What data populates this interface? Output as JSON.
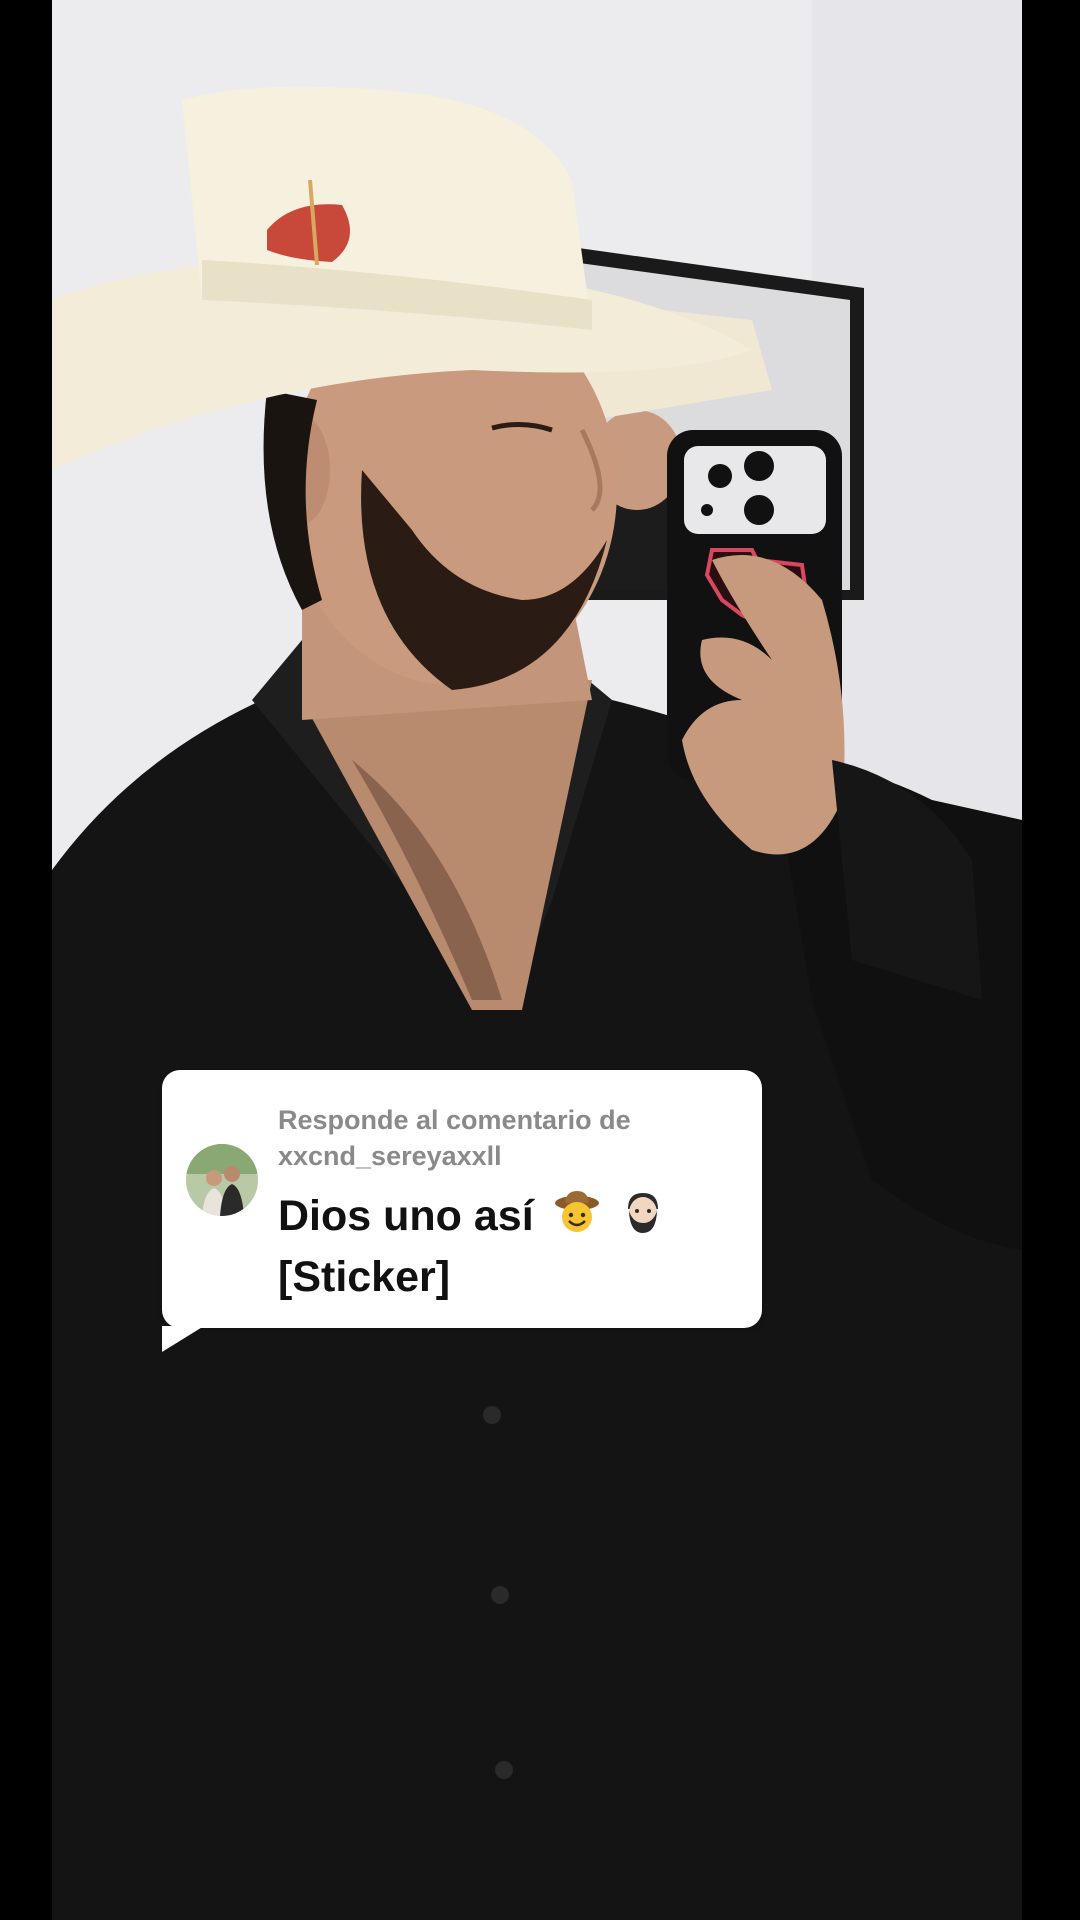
{
  "reply": {
    "header_line1": "Responde al comentario de",
    "header_line2": "xxcnd_sereyaxxll",
    "text_line1": "Dios uno así",
    "emoji1": "cowboy-face-emoji",
    "emoji2": "bearded-man-emoji",
    "text_line2": "[Sticker]"
  },
  "colors": {
    "background": "#ecebee",
    "bubble": "#ffffff",
    "header_text": "#8a8a8a",
    "body_text": "#111111",
    "shirt": "#141414",
    "hat": "#f3ecd8"
  }
}
